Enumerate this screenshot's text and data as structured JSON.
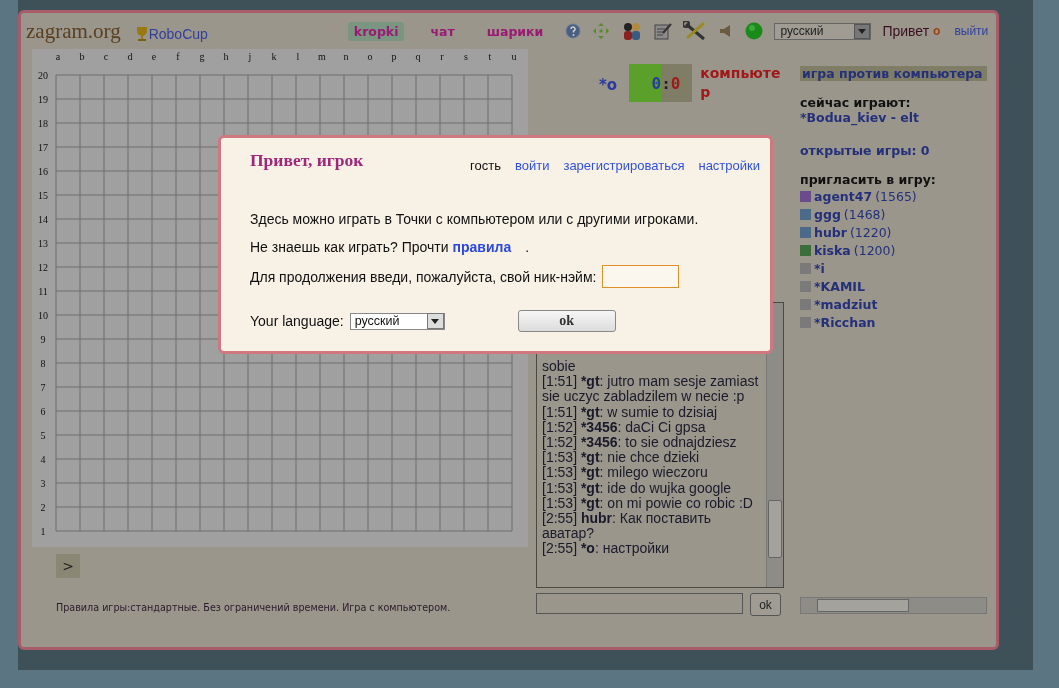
{
  "header": {
    "logo": "zagram.org",
    "robocup": "RoboCup",
    "tabs": [
      {
        "label": "kropki",
        "selected": true
      },
      {
        "label": "чат",
        "selected": false
      },
      {
        "label": "шарики",
        "selected": false
      }
    ],
    "toolbar": [
      {
        "kind": "help"
      },
      {
        "kind": "move"
      },
      {
        "kind": "people"
      },
      {
        "kind": "edit"
      },
      {
        "kind": "tools"
      },
      {
        "kind": "sound"
      },
      {
        "kind": "status"
      }
    ],
    "language": "русский",
    "greeting": "Привет",
    "user": "o",
    "logout": "выйти"
  },
  "board": {
    "columns": [
      "a",
      "b",
      "c",
      "d",
      "e",
      "f",
      "g",
      "h",
      "j",
      "k",
      "l",
      "m",
      "n",
      "o",
      "p",
      "q",
      "r",
      "s",
      "t",
      "u"
    ],
    "rows": [
      "20",
      "19",
      "18",
      "17",
      "16",
      "15",
      "14",
      "13",
      "12",
      "11",
      "10",
      "9",
      "8",
      "7",
      "6",
      "5",
      "4",
      "3",
      "2",
      "1"
    ],
    "next": ">"
  },
  "rules": "Правила игры:стандартные. Без ограничений времени. Игра с компьютером.",
  "score": {
    "player": "*o",
    "player_score": "0",
    "separator": ":",
    "opponent_score": "0",
    "opponent": "компьютер"
  },
  "chat": {
    "messages": [
      {
        "text": "sobie"
      },
      {
        "time": "[1:51]",
        "nick": "*gt",
        "text": ": jutro mam sesje zamiast sie uczyc zabladzilem w necie :p"
      },
      {
        "time": "[1:51]",
        "nick": "*gt",
        "text": ": w sumie to dzisiaj"
      },
      {
        "time": "[1:52]",
        "nick": "*3456",
        "text": ": daCi Ci gpsa"
      },
      {
        "time": "[1:52]",
        "nick": "*3456",
        "text": ": to sie odnajdziesz"
      },
      {
        "time": "[1:53]",
        "nick": "*gt",
        "text": ": nie chce dzieki"
      },
      {
        "time": "[1:53]",
        "nick": "*gt",
        "text": ": milego wieczoru"
      },
      {
        "time": "[1:53]",
        "nick": "*gt",
        "text": ": ide do wujka google"
      },
      {
        "time": "[1:53]",
        "nick": "*gt",
        "text": ": on mi powie co robic :D"
      },
      {
        "time": "[2:55]",
        "nick": "hubr",
        "text": ": Как поставить аватар?"
      },
      {
        "time": "[2:55]",
        "nick": "*o",
        "text": ": настройки"
      }
    ],
    "send": "ok"
  },
  "sidebar": {
    "title": "игра против компьютера",
    "playing_heading": "сейчас играют:",
    "playing": "*Bodua_kiev - elt",
    "open_games": "открытые игры: 0",
    "invite_heading": "пригласить в игру:",
    "players": [
      {
        "name": "agent47",
        "rating": "(1565)",
        "color": "#6a4c8c"
      },
      {
        "name": "ggg",
        "rating": "(1468)",
        "color": "#4c6a8a"
      },
      {
        "name": "hubr",
        "rating": "(1220)",
        "color": "#4c6a8a"
      },
      {
        "name": "kiska",
        "rating": "(1200)",
        "color": "#3c6e3c"
      },
      {
        "name": "*i",
        "color": "#7a7a7a"
      },
      {
        "name": "*KAMIL",
        "color": "#7a7a7a"
      },
      {
        "name": "*madziut",
        "color": "#7a7a7a"
      },
      {
        "name": "*Ricchan",
        "color": "#7a7a7a"
      }
    ]
  },
  "dialog": {
    "title": "Привет, игрок",
    "links": [
      {
        "label": "гость",
        "selected": true
      },
      {
        "label": "войти",
        "selected": false
      },
      {
        "label": "зарегистрироваться",
        "selected": false
      },
      {
        "label": "настройки",
        "selected": false
      }
    ],
    "intro": "Здесь можно играть в Точки с компьютером или с другими игроками.",
    "rules_prompt": "Не знаешь как играть? Прочти",
    "rules_link": "правила",
    "rules_end": ".",
    "nick_label": "Для продолжения введи, пожалуйста, свой ник-нэйм:",
    "language_label": "Your language:",
    "language": "русский",
    "ok": "ok"
  }
}
